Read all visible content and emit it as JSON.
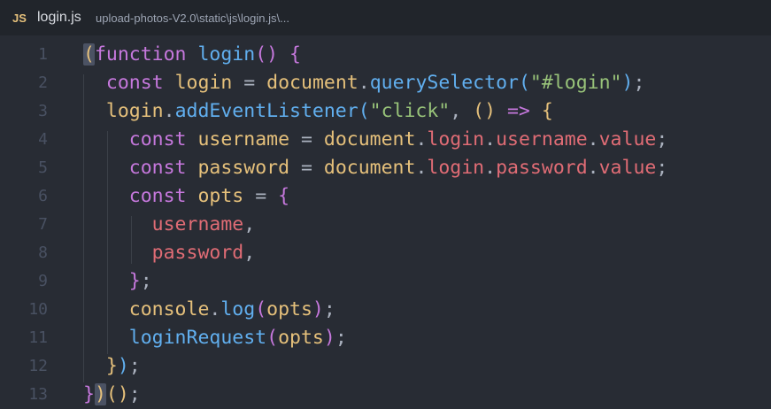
{
  "tab": {
    "lang_badge": "JS",
    "filename": "login.js",
    "path": "upload-photos-V2.0\\static\\js\\login.js\\..."
  },
  "editor": {
    "line_numbers": [
      "1",
      "2",
      "3",
      "4",
      "5",
      "6",
      "7",
      "8",
      "9",
      "10",
      "11",
      "12",
      "13"
    ],
    "lines": [
      [
        {
          "t": "(",
          "c": "br1",
          "m": true
        },
        {
          "t": "function",
          "c": "kw"
        },
        {
          "t": " ",
          "c": "pun"
        },
        {
          "t": "login",
          "c": "fn"
        },
        {
          "t": "()",
          "c": "br2"
        },
        {
          "t": " ",
          "c": "pun"
        },
        {
          "t": "{",
          "c": "br2"
        }
      ],
      [
        {
          "t": "  ",
          "c": "pun"
        },
        {
          "t": "const",
          "c": "kw"
        },
        {
          "t": " ",
          "c": "pun"
        },
        {
          "t": "login",
          "c": "var"
        },
        {
          "t": " ",
          "c": "pun"
        },
        {
          "t": "=",
          "c": "pun"
        },
        {
          "t": " ",
          "c": "pun"
        },
        {
          "t": "document",
          "c": "var"
        },
        {
          "t": ".",
          "c": "pun"
        },
        {
          "t": "querySelector",
          "c": "fn"
        },
        {
          "t": "(",
          "c": "br3"
        },
        {
          "t": "\"#login\"",
          "c": "str"
        },
        {
          "t": ")",
          "c": "br3"
        },
        {
          "t": ";",
          "c": "pun"
        }
      ],
      [
        {
          "t": "  ",
          "c": "pun"
        },
        {
          "t": "login",
          "c": "var"
        },
        {
          "t": ".",
          "c": "pun"
        },
        {
          "t": "addEventListener",
          "c": "fn"
        },
        {
          "t": "(",
          "c": "br3"
        },
        {
          "t": "\"click\"",
          "c": "str"
        },
        {
          "t": ", ",
          "c": "pun"
        },
        {
          "t": "()",
          "c": "br1"
        },
        {
          "t": " ",
          "c": "pun"
        },
        {
          "t": "=>",
          "c": "kw"
        },
        {
          "t": " ",
          "c": "pun"
        },
        {
          "t": "{",
          "c": "br1"
        }
      ],
      [
        {
          "t": "    ",
          "c": "pun"
        },
        {
          "t": "const",
          "c": "kw"
        },
        {
          "t": " ",
          "c": "pun"
        },
        {
          "t": "username",
          "c": "var"
        },
        {
          "t": " ",
          "c": "pun"
        },
        {
          "t": "=",
          "c": "pun"
        },
        {
          "t": " ",
          "c": "pun"
        },
        {
          "t": "document",
          "c": "var"
        },
        {
          "t": ".",
          "c": "pun"
        },
        {
          "t": "login",
          "c": "prop"
        },
        {
          "t": ".",
          "c": "pun"
        },
        {
          "t": "username",
          "c": "prop"
        },
        {
          "t": ".",
          "c": "pun"
        },
        {
          "t": "value",
          "c": "prop"
        },
        {
          "t": ";",
          "c": "pun"
        }
      ],
      [
        {
          "t": "    ",
          "c": "pun"
        },
        {
          "t": "const",
          "c": "kw"
        },
        {
          "t": " ",
          "c": "pun"
        },
        {
          "t": "password",
          "c": "var"
        },
        {
          "t": " ",
          "c": "pun"
        },
        {
          "t": "=",
          "c": "pun"
        },
        {
          "t": " ",
          "c": "pun"
        },
        {
          "t": "document",
          "c": "var"
        },
        {
          "t": ".",
          "c": "pun"
        },
        {
          "t": "login",
          "c": "prop"
        },
        {
          "t": ".",
          "c": "pun"
        },
        {
          "t": "password",
          "c": "prop"
        },
        {
          "t": ".",
          "c": "pun"
        },
        {
          "t": "value",
          "c": "prop"
        },
        {
          "t": ";",
          "c": "pun"
        }
      ],
      [
        {
          "t": "    ",
          "c": "pun"
        },
        {
          "t": "const",
          "c": "kw"
        },
        {
          "t": " ",
          "c": "pun"
        },
        {
          "t": "opts",
          "c": "var"
        },
        {
          "t": " ",
          "c": "pun"
        },
        {
          "t": "=",
          "c": "pun"
        },
        {
          "t": " ",
          "c": "pun"
        },
        {
          "t": "{",
          "c": "br2"
        }
      ],
      [
        {
          "t": "      ",
          "c": "pun"
        },
        {
          "t": "username",
          "c": "prop"
        },
        {
          "t": ",",
          "c": "pun"
        }
      ],
      [
        {
          "t": "      ",
          "c": "pun"
        },
        {
          "t": "password",
          "c": "prop"
        },
        {
          "t": ",",
          "c": "pun"
        }
      ],
      [
        {
          "t": "    ",
          "c": "pun"
        },
        {
          "t": "}",
          "c": "br2"
        },
        {
          "t": ";",
          "c": "pun"
        }
      ],
      [
        {
          "t": "    ",
          "c": "pun"
        },
        {
          "t": "console",
          "c": "var"
        },
        {
          "t": ".",
          "c": "pun"
        },
        {
          "t": "log",
          "c": "fn"
        },
        {
          "t": "(",
          "c": "br2"
        },
        {
          "t": "opts",
          "c": "var"
        },
        {
          "t": ")",
          "c": "br2"
        },
        {
          "t": ";",
          "c": "pun"
        }
      ],
      [
        {
          "t": "    ",
          "c": "pun"
        },
        {
          "t": "loginRequest",
          "c": "fn"
        },
        {
          "t": "(",
          "c": "br2"
        },
        {
          "t": "opts",
          "c": "var"
        },
        {
          "t": ")",
          "c": "br2"
        },
        {
          "t": ";",
          "c": "pun"
        }
      ],
      [
        {
          "t": "  ",
          "c": "pun"
        },
        {
          "t": "}",
          "c": "br1"
        },
        {
          "t": ")",
          "c": "br3"
        },
        {
          "t": ";",
          "c": "pun"
        }
      ],
      [
        {
          "t": "}",
          "c": "br2"
        },
        {
          "t": ")",
          "c": "br1",
          "m": true
        },
        {
          "t": "()",
          "c": "br1"
        },
        {
          "t": ";",
          "c": "pun"
        }
      ]
    ]
  },
  "colors": {
    "background": "#282c34",
    "keyword": "#c678dd",
    "function": "#61afef",
    "variable": "#e5c07b",
    "string": "#98c379",
    "property": "#e06c75",
    "gutter": "#495162"
  }
}
